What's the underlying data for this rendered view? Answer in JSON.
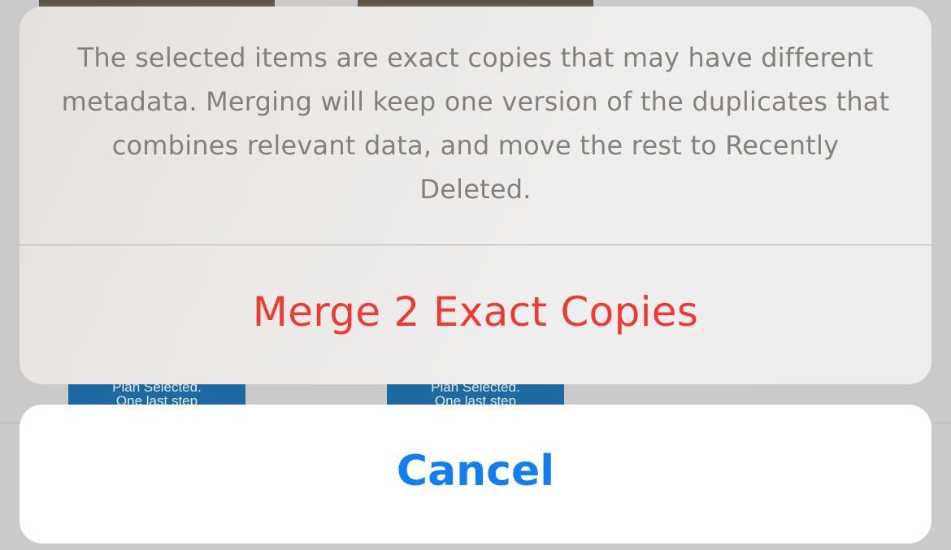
{
  "background": {
    "thumbnail_caption_line1": "Plan Selected.",
    "thumbnail_caption_line2": "One last step"
  },
  "action_sheet": {
    "message": "The selected items are exact copies that may have different metadata. Merging will keep one version of the duplicates that combines relevant data, and move the rest to Recently Deleted.",
    "merge_label": "Merge 2 Exact Copies",
    "cancel_label": "Cancel"
  },
  "colors": {
    "destructive": "#ee3a33",
    "accent": "#127ef0",
    "message_text": "#858079"
  }
}
